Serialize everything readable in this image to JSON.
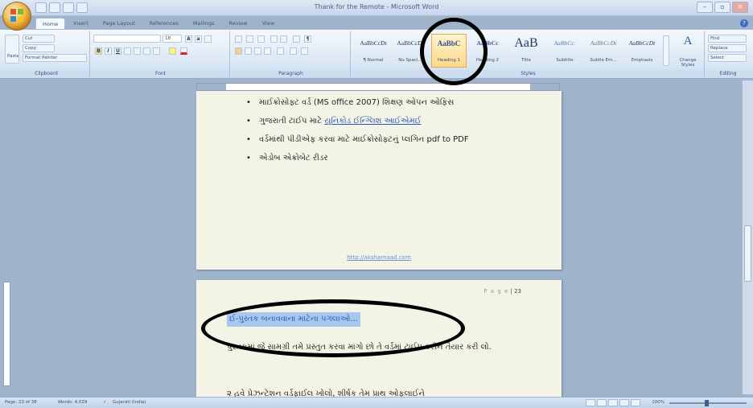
{
  "window": {
    "title": "Thank for the Remote - Microsoft Word",
    "controls": [
      "–",
      "▫",
      "✕"
    ]
  },
  "tabs": [
    "Home",
    "Insert",
    "Page Layout",
    "References",
    "Mailings",
    "Review",
    "View"
  ],
  "ribbon": {
    "clipboard": {
      "label": "Clipboard",
      "paste": "Paste",
      "cut": "Cut",
      "copy": "Copy",
      "format_painter": "Format Painter"
    },
    "font": {
      "label": "Font",
      "size": "18",
      "bold": "B",
      "italic": "I",
      "underline": "U"
    },
    "paragraph": {
      "label": "Paragraph"
    },
    "styles": {
      "label": "Styles",
      "items": [
        {
          "preview": "AaBbCcDt",
          "name": "¶ Normal"
        },
        {
          "preview": "AaBbCcDt",
          "name": "No Spaci..."
        },
        {
          "preview": "AaBbC",
          "name": "Heading 1"
        },
        {
          "preview": "AaBbCc",
          "name": "Heading 2"
        },
        {
          "preview": "AaB",
          "name": "Title"
        },
        {
          "preview": "AaBbCc.",
          "name": "Subtitle"
        },
        {
          "preview": "AaBbCcDt",
          "name": "Subtle Em..."
        },
        {
          "preview": "AaBbCcDt",
          "name": "Emphasis"
        }
      ],
      "selected_index": 2,
      "change_styles": "Change Styles"
    },
    "editing": {
      "label": "Editing",
      "find": "Find",
      "replace": "Replace",
      "select": "Select"
    }
  },
  "page1": {
    "bullets": [
      "માઈક્રોસોફ્ટ વર્ડ (MS office 2007) શિક્ષણ ઓપન ઓફિસ",
      "ગુજરાતી ટાઈપ માટે યુનિકોડ ઈન્ગ્લિશ આઈએમઈ",
      "વર્ડમાંથી પીડીએફ કરવા માટે માઈક્રોસોફ્ટનું પ્લગિન pdf to PDF",
      "એડોબ એક્રોબેટ રીડર"
    ],
    "link_text": "યુનિકોડ ઈન્ગ્લિશ આઈએમઈ",
    "footer_url": "http://aksharnaad.com"
  },
  "page2": {
    "page_word": "P a g e",
    "page_number": "| 23",
    "heading": "ઈ-પુસ્તક બનાવવાના માટેના પગલાઓ...",
    "body": "પુસ્તકમાં જે સામગ્રી તમે પ્રસ્તુત કરવા માંગો છો તે વર્ડમાં ટાઈપ કરીને તૈયાર કરી લો.",
    "body2": "૨ હવે પ્રેઝન્ટેશન વર્ડફાઈલ ખોલો, શીર્ષક તેમ પ્રાથ ઓફલાઈને"
  },
  "status": {
    "page": "Page: 23 of 38",
    "words": "Words: 4,029",
    "language": "Gujarati (India)",
    "zoom": "100%"
  }
}
